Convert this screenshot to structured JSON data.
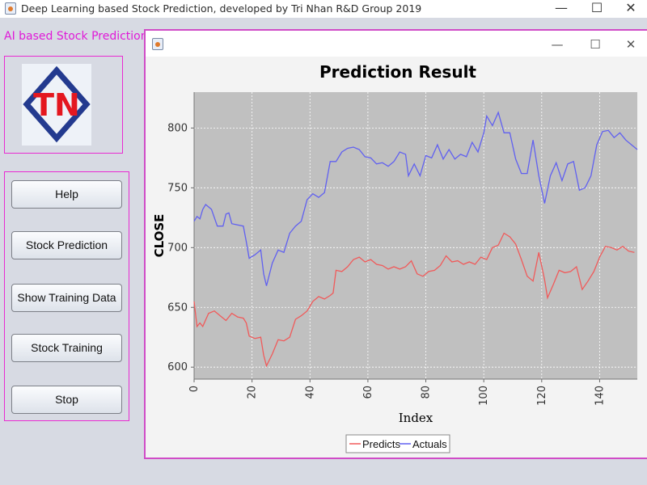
{
  "window": {
    "title": "Deep Learning based Stock Prediction, developed by Tri Nhan R&D Group 2019",
    "minimize_glyph": "—",
    "maximize_glyph": "☐",
    "close_glyph": "✕"
  },
  "left_panel": {
    "title": "AI based Stock Prediction",
    "logo_text": "TN",
    "buttons": [
      {
        "label": "Help"
      },
      {
        "label": "Stock Prediction"
      },
      {
        "label": "Show Training Data"
      },
      {
        "label": "Stock Training"
      },
      {
        "label": "Stop"
      }
    ]
  },
  "child_window": {
    "minimize_glyph": "—",
    "maximize_glyph": "☐",
    "close_glyph": "✕"
  },
  "colors": {
    "accent_magenta": "#e01ad8",
    "plot_background": "#c0c0c0",
    "predicts": "#f05a5a",
    "actuals": "#6060f0",
    "logo_red": "#e4171f",
    "logo_blue": "#233a8f"
  },
  "chart_data": {
    "type": "line",
    "title": "Prediction Result",
    "xlabel": "Index",
    "ylabel": "CLOSE",
    "xlim": [
      0,
      153
    ],
    "ylim": [
      590,
      830
    ],
    "xticks": [
      0,
      20,
      40,
      60,
      80,
      100,
      120,
      140
    ],
    "yticks": [
      600,
      650,
      700,
      750,
      800
    ],
    "grid": true,
    "legend": "bottom-center",
    "series": [
      {
        "name": "Predicts",
        "points": [
          [
            0,
            655
          ],
          [
            1,
            634
          ],
          [
            2,
            637
          ],
          [
            3,
            634
          ],
          [
            5,
            645
          ],
          [
            7,
            647
          ],
          [
            9,
            643
          ],
          [
            11,
            639
          ],
          [
            13,
            645
          ],
          [
            15,
            642
          ],
          [
            17,
            641
          ],
          [
            18,
            637
          ],
          [
            19,
            626
          ],
          [
            21,
            624
          ],
          [
            23,
            625
          ],
          [
            24,
            610
          ],
          [
            25,
            601
          ],
          [
            27,
            611
          ],
          [
            29,
            623
          ],
          [
            31,
            622
          ],
          [
            33,
            625
          ],
          [
            35,
            640
          ],
          [
            37,
            643
          ],
          [
            39,
            647
          ],
          [
            41,
            655
          ],
          [
            43,
            659
          ],
          [
            45,
            657
          ],
          [
            47,
            660
          ],
          [
            48,
            662
          ],
          [
            49,
            681
          ],
          [
            51,
            680
          ],
          [
            53,
            684
          ],
          [
            55,
            690
          ],
          [
            57,
            692
          ],
          [
            59,
            688
          ],
          [
            61,
            690
          ],
          [
            63,
            686
          ],
          [
            65,
            685
          ],
          [
            67,
            682
          ],
          [
            69,
            684
          ],
          [
            71,
            682
          ],
          [
            73,
            684
          ],
          [
            75,
            689
          ],
          [
            77,
            678
          ],
          [
            79,
            676
          ],
          [
            81,
            680
          ],
          [
            83,
            681
          ],
          [
            85,
            685
          ],
          [
            87,
            693
          ],
          [
            89,
            688
          ],
          [
            91,
            689
          ],
          [
            93,
            686
          ],
          [
            95,
            688
          ],
          [
            97,
            686
          ],
          [
            99,
            692
          ],
          [
            101,
            690
          ],
          [
            103,
            700
          ],
          [
            105,
            702
          ],
          [
            107,
            712
          ],
          [
            109,
            709
          ],
          [
            111,
            703
          ],
          [
            113,
            690
          ],
          [
            115,
            676
          ],
          [
            117,
            672
          ],
          [
            119,
            696
          ],
          [
            121,
            673
          ],
          [
            122,
            658
          ],
          [
            124,
            669
          ],
          [
            126,
            681
          ],
          [
            128,
            679
          ],
          [
            130,
            680
          ],
          [
            132,
            684
          ],
          [
            134,
            665
          ],
          [
            136,
            672
          ],
          [
            138,
            680
          ],
          [
            140,
            692
          ],
          [
            142,
            701
          ],
          [
            144,
            700
          ],
          [
            146,
            698
          ],
          [
            148,
            701
          ],
          [
            150,
            697
          ],
          [
            152,
            696
          ]
        ]
      },
      {
        "name": "Actuals",
        "points": [
          [
            0,
            722
          ],
          [
            1,
            726
          ],
          [
            2,
            724
          ],
          [
            3,
            732
          ],
          [
            4,
            736
          ],
          [
            6,
            732
          ],
          [
            8,
            718
          ],
          [
            10,
            718
          ],
          [
            11,
            728
          ],
          [
            12,
            729
          ],
          [
            13,
            720
          ],
          [
            15,
            719
          ],
          [
            17,
            718
          ],
          [
            18,
            705
          ],
          [
            19,
            691
          ],
          [
            21,
            694
          ],
          [
            23,
            698
          ],
          [
            24,
            678
          ],
          [
            25,
            668
          ],
          [
            27,
            687
          ],
          [
            29,
            698
          ],
          [
            31,
            696
          ],
          [
            33,
            712
          ],
          [
            35,
            718
          ],
          [
            37,
            722
          ],
          [
            39,
            740
          ],
          [
            41,
            745
          ],
          [
            43,
            742
          ],
          [
            45,
            746
          ],
          [
            47,
            772
          ],
          [
            49,
            772
          ],
          [
            51,
            780
          ],
          [
            53,
            783
          ],
          [
            55,
            784
          ],
          [
            57,
            782
          ],
          [
            59,
            776
          ],
          [
            61,
            775
          ],
          [
            63,
            770
          ],
          [
            65,
            771
          ],
          [
            67,
            768
          ],
          [
            69,
            772
          ],
          [
            71,
            780
          ],
          [
            73,
            778
          ],
          [
            74,
            760
          ],
          [
            76,
            770
          ],
          [
            78,
            760
          ],
          [
            80,
            777
          ],
          [
            82,
            775
          ],
          [
            84,
            786
          ],
          [
            86,
            774
          ],
          [
            88,
            782
          ],
          [
            90,
            774
          ],
          [
            92,
            778
          ],
          [
            94,
            776
          ],
          [
            96,
            788
          ],
          [
            98,
            780
          ],
          [
            100,
            796
          ],
          [
            101,
            810
          ],
          [
            103,
            802
          ],
          [
            105,
            813
          ],
          [
            107,
            796
          ],
          [
            109,
            796
          ],
          [
            111,
            774
          ],
          [
            113,
            762
          ],
          [
            115,
            762
          ],
          [
            117,
            790
          ],
          [
            119,
            760
          ],
          [
            121,
            737
          ],
          [
            123,
            760
          ],
          [
            125,
            771
          ],
          [
            127,
            756
          ],
          [
            129,
            770
          ],
          [
            131,
            772
          ],
          [
            133,
            748
          ],
          [
            135,
            750
          ],
          [
            137,
            760
          ],
          [
            139,
            786
          ],
          [
            141,
            797
          ],
          [
            143,
            798
          ],
          [
            145,
            792
          ],
          [
            147,
            796
          ],
          [
            149,
            790
          ],
          [
            151,
            786
          ],
          [
            153,
            782
          ]
        ]
      }
    ]
  }
}
